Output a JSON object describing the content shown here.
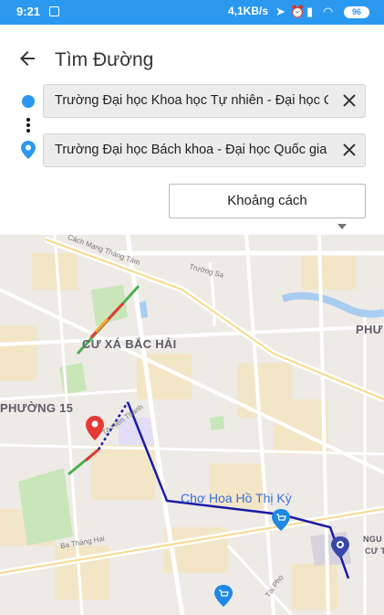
{
  "status_bar": {
    "time": "9:21",
    "net_speed": "4,1KB/s",
    "battery": "96"
  },
  "header": {
    "title": "Tìm Đường",
    "origin": "Trường Đại học Khoa học Tự nhiên - Đại học Q",
    "destination": "Trường Đại học Bách khoa - Đại học Quốc gia",
    "sort_option": "Khoảng cách"
  },
  "map": {
    "labels": {
      "cu_xa_bac_hai": "CƯ XÁ BẮC HẢI",
      "phuong_15": "PHƯỜNG 15",
      "phuong_right": "PHƯ",
      "market": "Chợ Hoa Hồ Thị Kỳ",
      "ngu": "NGU",
      "cu_tr": "CƯ TR",
      "cach_mang_thang_tam": "Cách Mạng Tháng Tám",
      "truong_sa": "Trường Sa",
      "to_hien_thanh": "Tô Hiến Thành",
      "ba_thang_hai": "Ba Tháng Hai",
      "tai_pho": "Tài Phọ"
    }
  },
  "colors": {
    "status_bar": "#2b98f0",
    "route": "#1a1aa8",
    "pin_red": "#e53935",
    "pin_blue": "#3949ab"
  }
}
